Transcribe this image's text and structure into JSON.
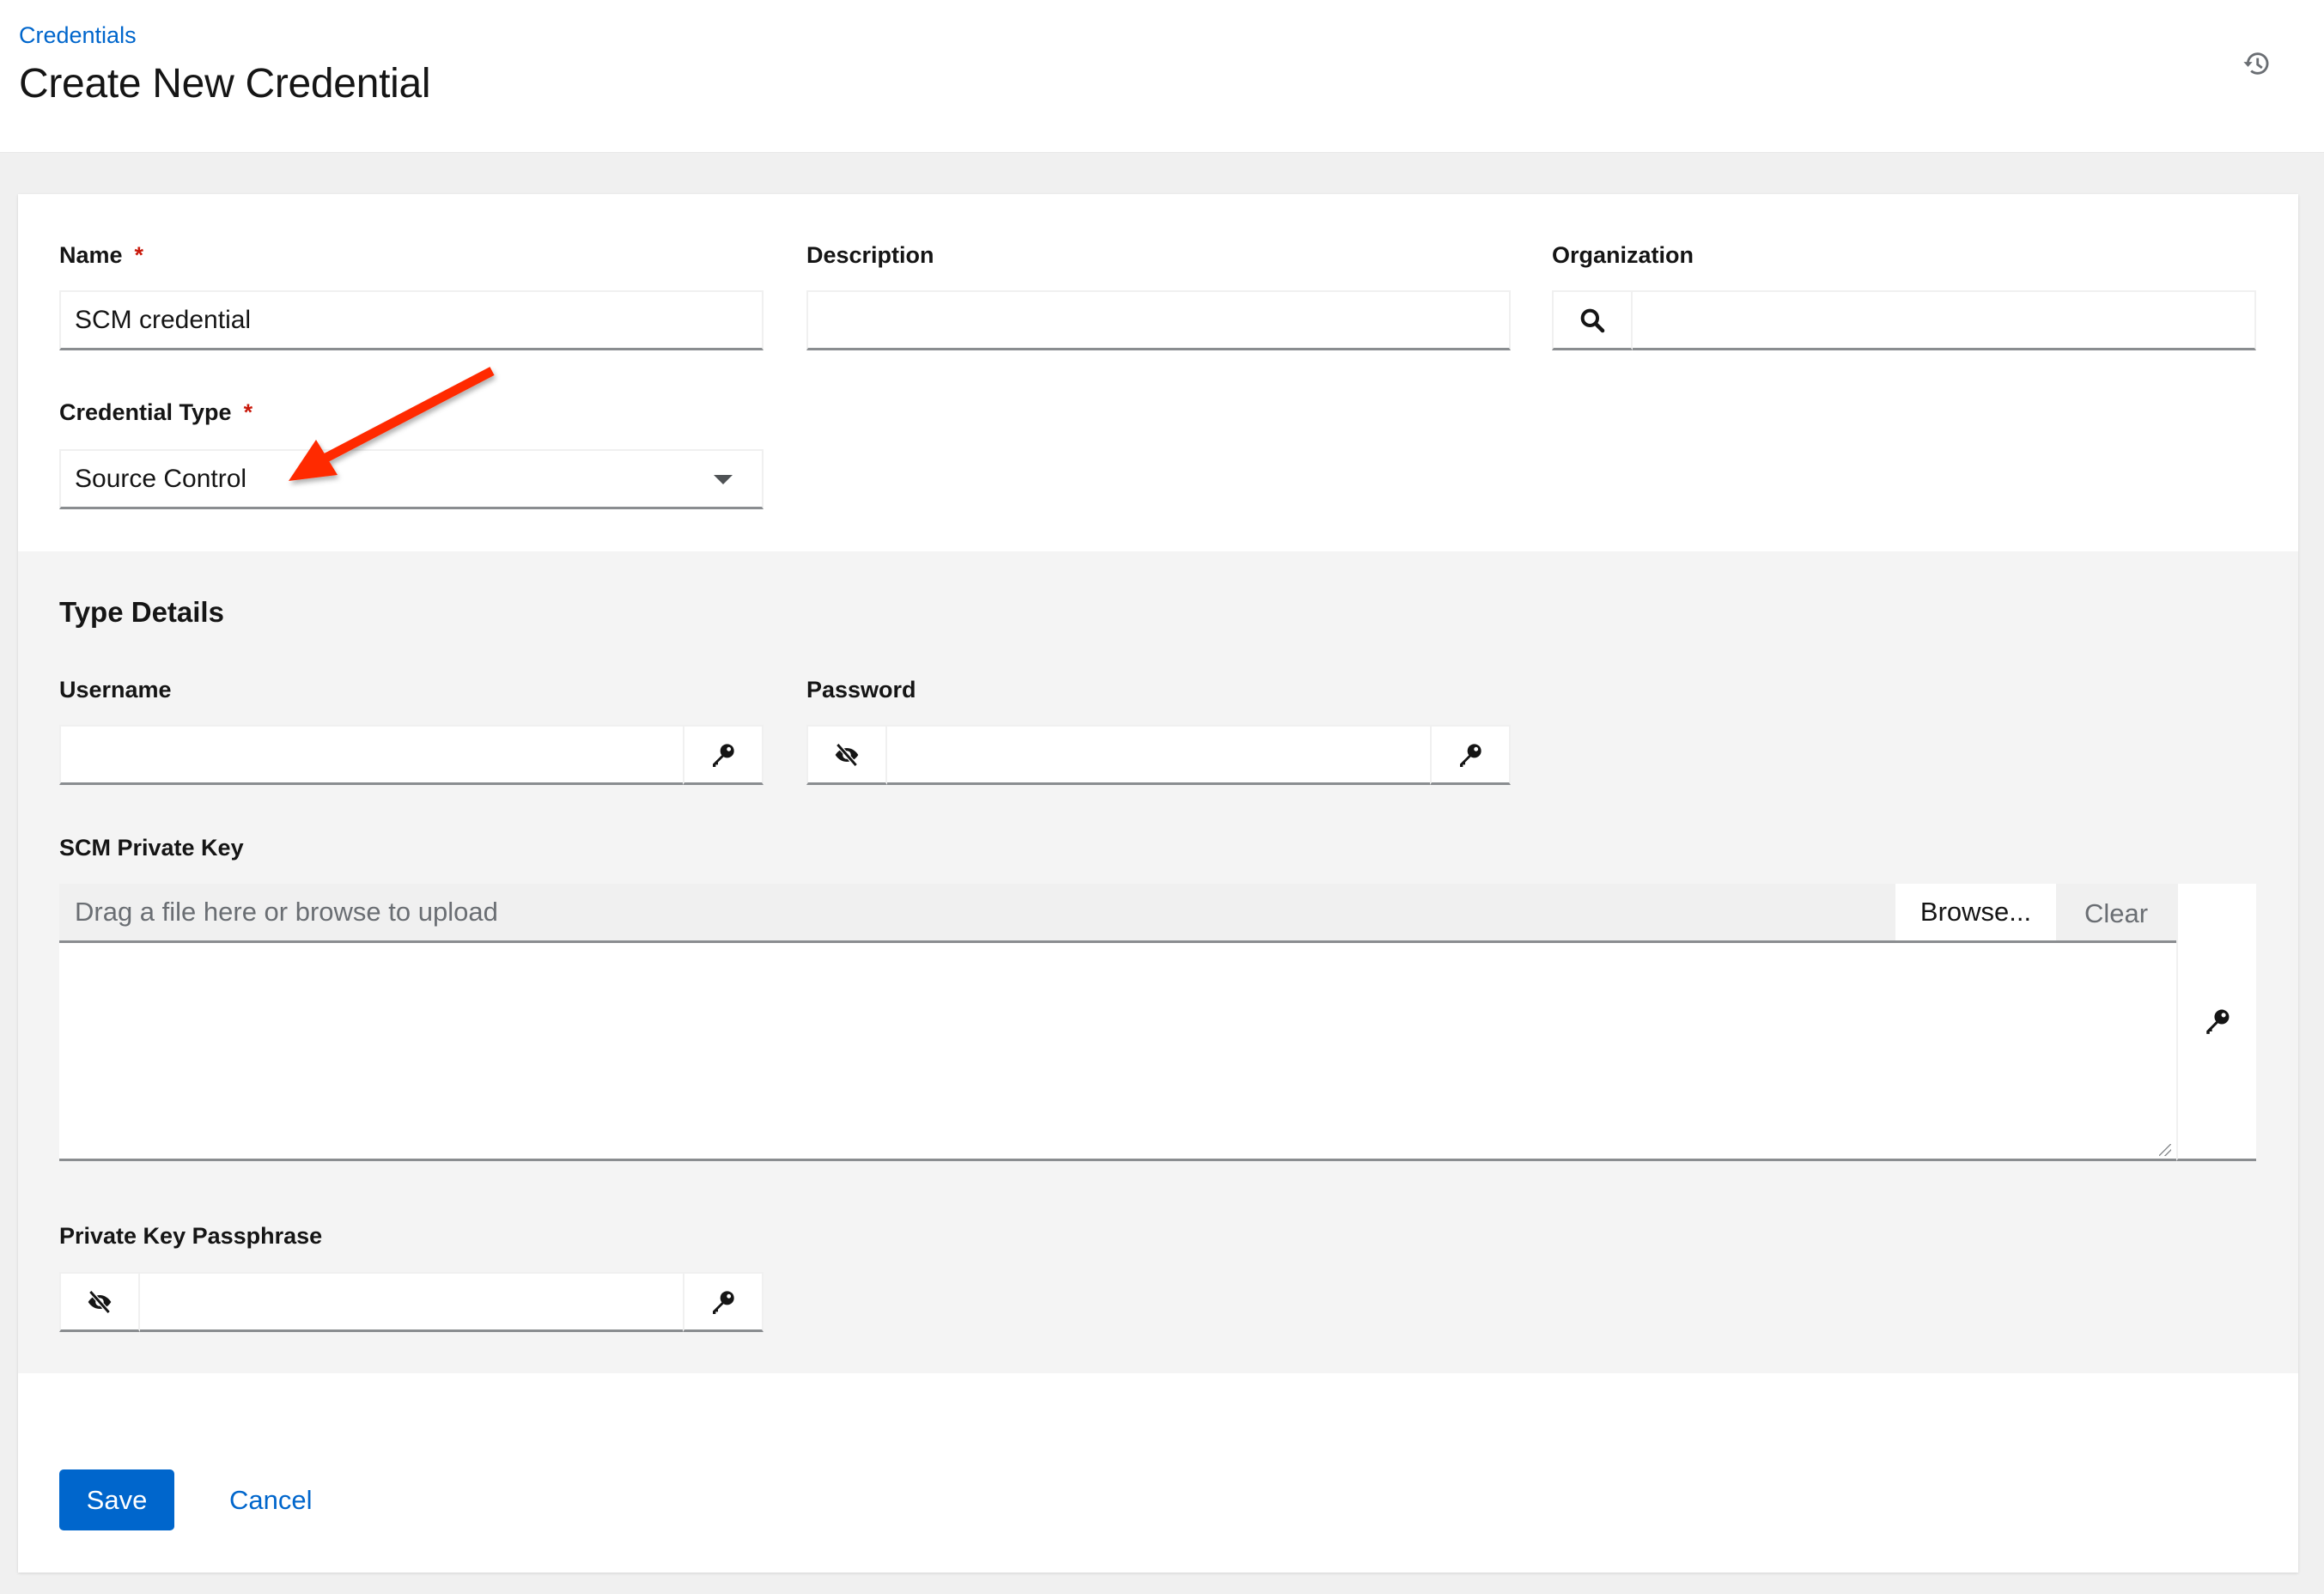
{
  "header": {
    "breadcrumb": "Credentials",
    "title": "Create New Credential",
    "history_icon": "history-icon"
  },
  "form": {
    "name": {
      "label": "Name",
      "required_mark": "*",
      "value": "SCM credential"
    },
    "description": {
      "label": "Description",
      "value": ""
    },
    "organization": {
      "label": "Organization",
      "value": "",
      "icon": "search-icon"
    },
    "credential_type": {
      "label": "Credential Type",
      "required_mark": "*",
      "selected": "Source Control",
      "icon": "caret-down-icon"
    }
  },
  "type_details": {
    "title": "Type Details",
    "username": {
      "label": "Username",
      "value": "",
      "icon": "key-icon"
    },
    "password": {
      "label": "Password",
      "value": "",
      "icons": [
        "eye-slash-icon",
        "key-icon"
      ]
    },
    "scm_private_key": {
      "label": "SCM Private Key",
      "placeholder": "Drag a file here or browse to upload",
      "browse_label": "Browse...",
      "clear_label": "Clear",
      "value": "",
      "icon": "key-icon"
    },
    "private_key_passphrase": {
      "label": "Private Key Passphrase",
      "value": "",
      "icons": [
        "eye-slash-icon",
        "key-icon"
      ]
    }
  },
  "actions": {
    "save_label": "Save",
    "cancel_label": "Cancel"
  },
  "colors": {
    "primary": "#0066cc",
    "required": "#c9190b",
    "annotation_arrow": "#ff2a00"
  }
}
